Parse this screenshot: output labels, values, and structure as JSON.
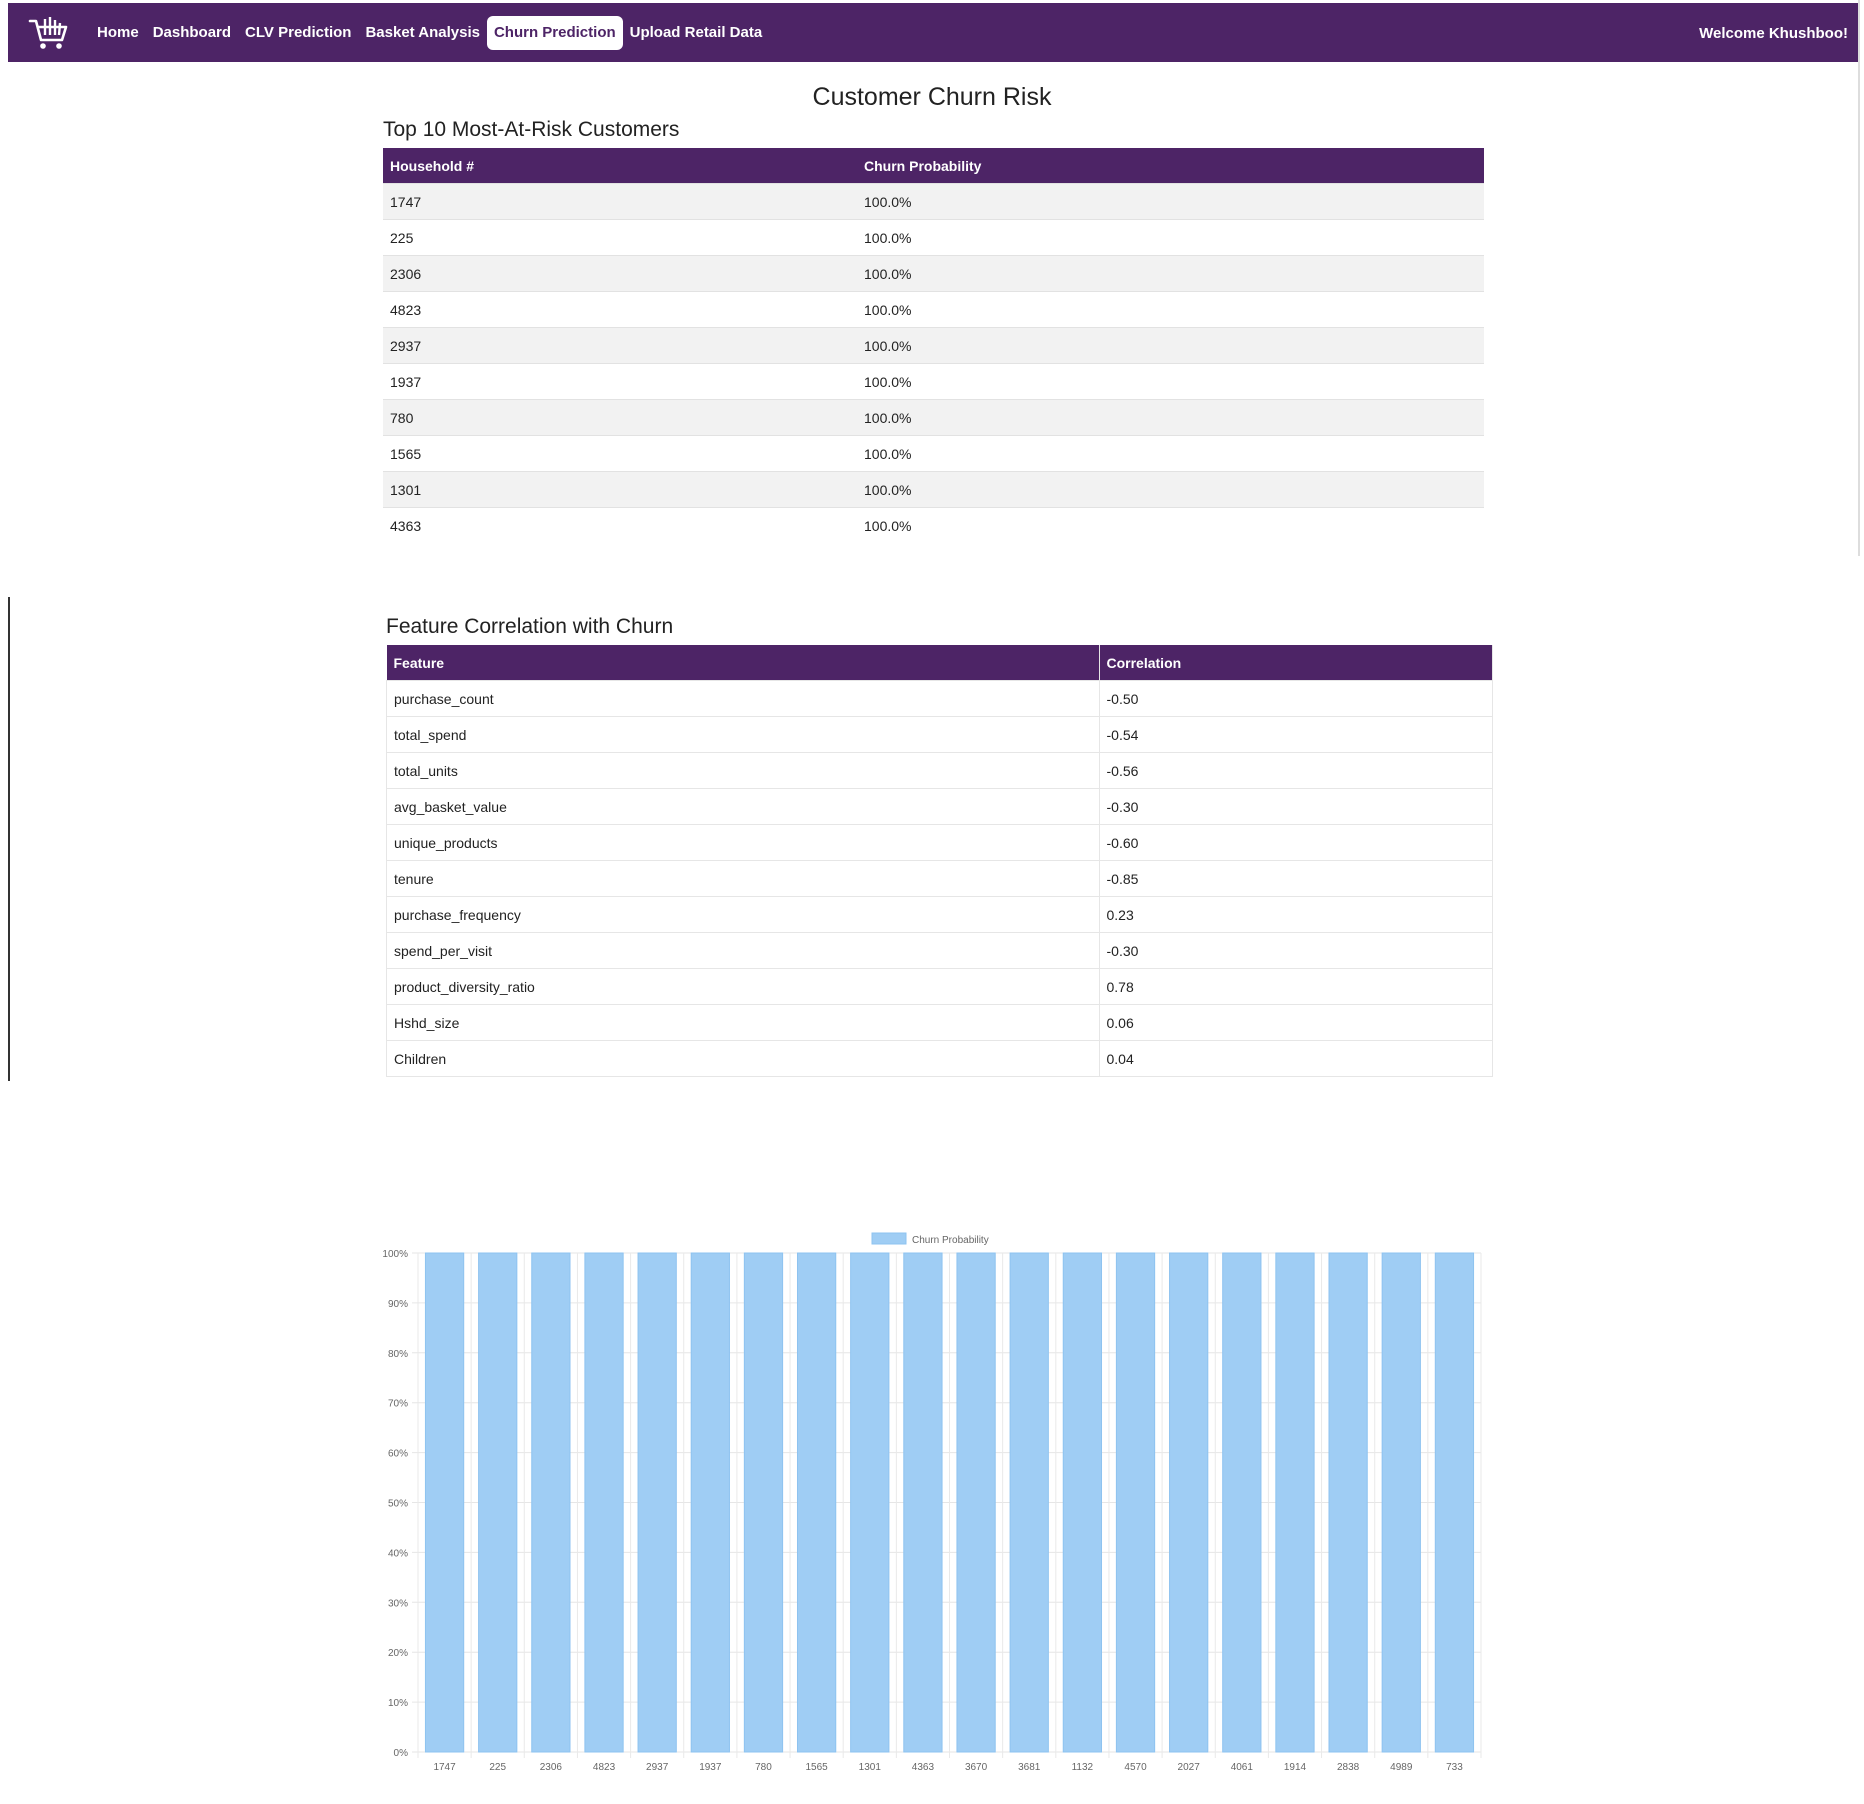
{
  "nav": {
    "items": [
      {
        "label": "Home",
        "active": false
      },
      {
        "label": "Dashboard",
        "active": false
      },
      {
        "label": "CLV Prediction",
        "active": false
      },
      {
        "label": "Basket Analysis",
        "active": false
      },
      {
        "label": "Churn Prediction",
        "active": true
      },
      {
        "label": "Upload Retail Data",
        "active": false
      }
    ],
    "welcome": "Welcome Khushboo!",
    "logo_icon": "shopping-cart-icon"
  },
  "page_title": "Customer Churn Risk",
  "risk_section": {
    "title": "Top 10 Most-At-Risk Customers",
    "headers": [
      "Household #",
      "Churn Probability"
    ],
    "rows": [
      [
        "1747",
        "100.0%"
      ],
      [
        "225",
        "100.0%"
      ],
      [
        "2306",
        "100.0%"
      ],
      [
        "4823",
        "100.0%"
      ],
      [
        "2937",
        "100.0%"
      ],
      [
        "1937",
        "100.0%"
      ],
      [
        "780",
        "100.0%"
      ],
      [
        "1565",
        "100.0%"
      ],
      [
        "1301",
        "100.0%"
      ],
      [
        "4363",
        "100.0%"
      ]
    ]
  },
  "corr_section": {
    "title": "Feature Correlation with Churn",
    "headers": [
      "Feature",
      "Correlation"
    ],
    "rows": [
      [
        "purchase_count",
        "-0.50"
      ],
      [
        "total_spend",
        "-0.54"
      ],
      [
        "total_units",
        "-0.56"
      ],
      [
        "avg_basket_value",
        "-0.30"
      ],
      [
        "unique_products",
        "-0.60"
      ],
      [
        "tenure",
        "-0.85"
      ],
      [
        "purchase_frequency",
        "0.23"
      ],
      [
        "spend_per_visit",
        "-0.30"
      ],
      [
        "product_diversity_ratio",
        "0.78"
      ],
      [
        "Hshd_size",
        "0.06"
      ],
      [
        "Children",
        "0.04"
      ]
    ]
  },
  "colors": {
    "brand": "#4d2466",
    "bar": "#9fcdf4",
    "bar_border": "#8ec3f0"
  },
  "chart_data": {
    "type": "bar",
    "categories": [
      "1747",
      "225",
      "2306",
      "4823",
      "2937",
      "1937",
      "780",
      "1565",
      "1301",
      "4363",
      "3670",
      "3681",
      "1132",
      "4570",
      "2027",
      "4061",
      "1914",
      "2838",
      "4989",
      "733"
    ],
    "series": [
      {
        "name": "Churn Probability",
        "values": [
          100,
          100,
          100,
          100,
          100,
          100,
          100,
          100,
          100,
          100,
          100,
          100,
          100,
          100,
          100,
          100,
          100,
          100,
          100,
          100
        ]
      }
    ],
    "ylim": [
      0,
      100
    ],
    "ytick_labels": [
      "0%",
      "10%",
      "20%",
      "30%",
      "40%",
      "50%",
      "60%",
      "70%",
      "80%",
      "90%",
      "100%"
    ],
    "legend_position": "top",
    "grid": true
  }
}
